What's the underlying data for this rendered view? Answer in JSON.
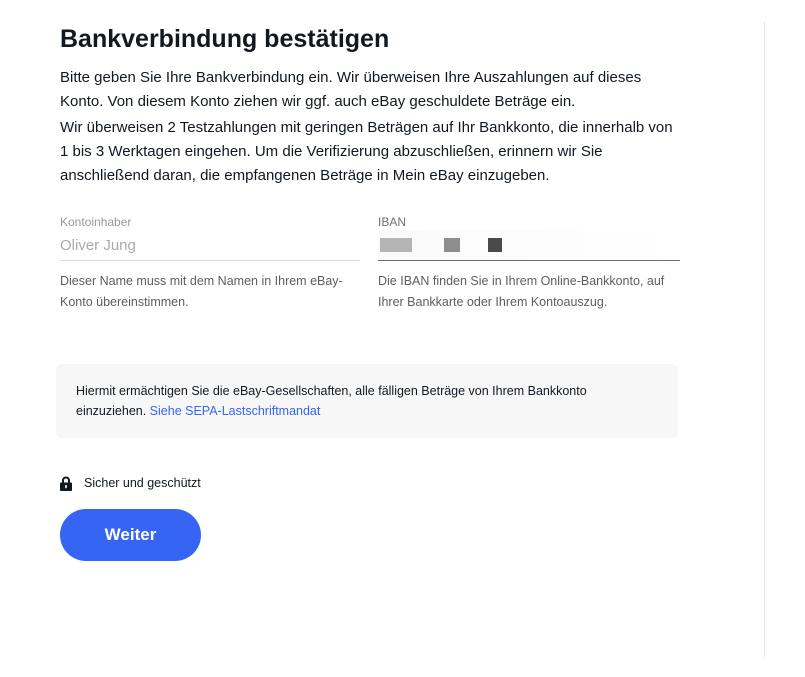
{
  "header": {
    "title": "Bankverbindung bestätigen"
  },
  "intro": {
    "paragraph1": "Bitte geben Sie Ihre Bankverbindung ein. Wir überweisen Ihre Auszahlungen auf dieses Konto. Von diesem Konto ziehen wir ggf. auch eBay geschuldete Beträge ein.",
    "paragraph2": "Wir überweisen 2 Testzahlungen mit geringen Beträgen auf Ihr Bankkonto, die innerhalb von 1 bis 3 Werktagen eingehen. Um die Verifizierung abzuschließen, erinnern wir Sie anschließend daran, die empfangenen Beträge in Mein eBay einzugeben."
  },
  "form": {
    "account_holder": {
      "label": "Kontoinhaber",
      "value": "Oliver Jung",
      "help": "Dieser Name muss mit dem Namen in Ihrem eBay-Konto übereinstimmen."
    },
    "iban": {
      "label": "IBAN",
      "help": "Die IBAN finden Sie in Ihrem Online-Bankkonto, auf Ihrer Bankkarte oder Ihrem Kontoauszug."
    }
  },
  "mandate": {
    "text": "Hiermit ermächtigen Sie die eBay-Gesellschaften, alle fälligen Beträge von Ihrem Bankkonto einzuziehen. ",
    "link_label": "Siehe SEPA-Lastschriftmandat"
  },
  "security": {
    "icon": "lock-icon",
    "label": "Sicher und geschützt"
  },
  "actions": {
    "continue_label": "Weiter"
  },
  "colors": {
    "accent": "#3665f3",
    "text": "#111820",
    "muted": "#5e5e5e",
    "panel": "#f7f7f7"
  }
}
